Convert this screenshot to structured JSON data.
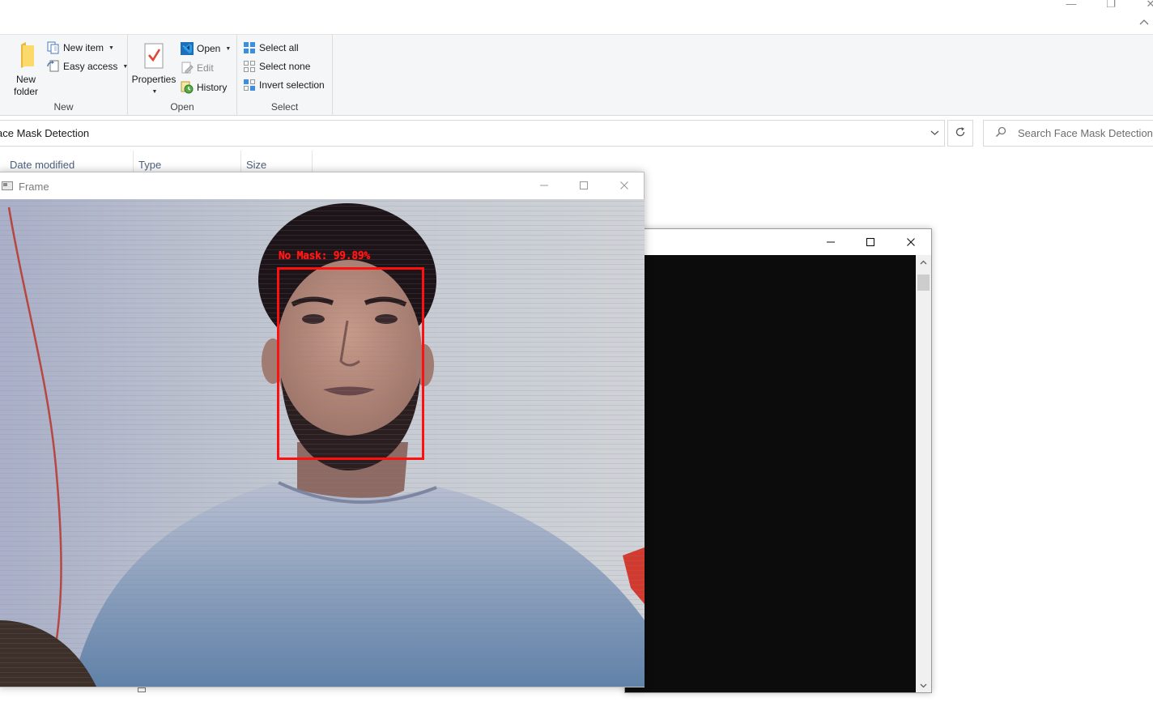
{
  "explorer": {
    "title_controls": {
      "minimize": "—",
      "restore": "❐",
      "close": "✕"
    },
    "ribbon": {
      "groups": {
        "new": {
          "label": "New",
          "new_folder": {
            "line1": "New",
            "line2": "folder"
          },
          "new_item": "New item",
          "easy_access": "Easy access"
        },
        "open": {
          "label": "Open",
          "properties": "Properties",
          "open": "Open",
          "edit": "Edit",
          "history": "History"
        },
        "select": {
          "label": "Select",
          "select_all": "Select all",
          "select_none": "Select none",
          "invert_selection": "Invert selection"
        }
      }
    },
    "address": {
      "path": "ace Mask Detection"
    },
    "search": {
      "placeholder": "Search Face Mask Detection"
    },
    "columns": [
      "Date modified",
      "Type",
      "Size"
    ]
  },
  "frame_window": {
    "title": "Frame",
    "detection": {
      "label": "No Mask: 99.89%",
      "color": "#ff1010"
    }
  },
  "console_window": {
    "background": "#0c0c0c"
  },
  "colors": {
    "ribbon_bg": "#f5f6f7",
    "accent": "#0078d7"
  }
}
